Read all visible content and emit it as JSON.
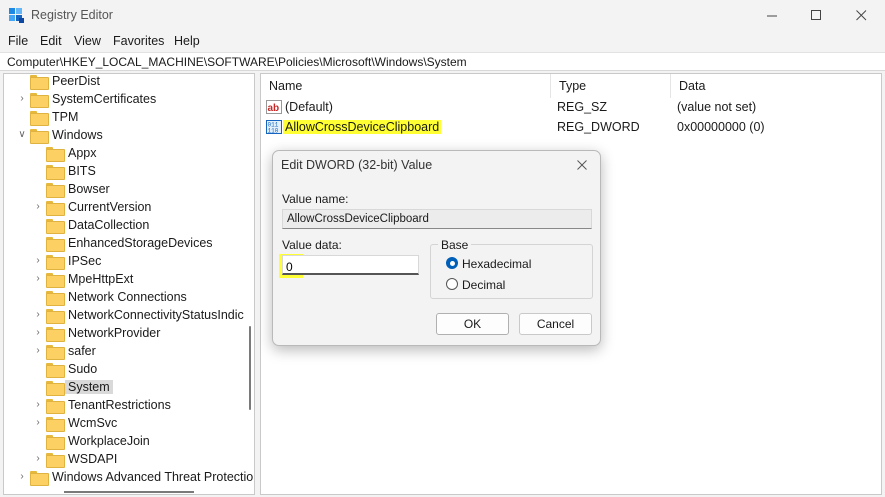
{
  "window": {
    "title": "Registry Editor",
    "minimize_icon": "minimize-icon",
    "maximize_icon": "maximize-icon",
    "close_icon": "close-icon"
  },
  "menu": [
    "File",
    "Edit",
    "View",
    "Favorites",
    "Help"
  ],
  "address": "Computer\\HKEY_LOCAL_MACHINE\\SOFTWARE\\Policies\\Microsoft\\Windows\\System",
  "tree": {
    "items": [
      {
        "label": "PeerDist",
        "expandable": false,
        "selected": false
      },
      {
        "label": "SystemCertificates",
        "expandable": true,
        "selected": false
      },
      {
        "label": "TPM",
        "expandable": false,
        "selected": false
      },
      {
        "label": "Windows",
        "expandable": true,
        "expanded": true,
        "selected": false
      },
      {
        "label": "Appx",
        "expandable": false,
        "selected": false
      },
      {
        "label": "BITS",
        "expandable": false,
        "selected": false
      },
      {
        "label": "Bowser",
        "expandable": false,
        "selected": false
      },
      {
        "label": "CurrentVersion",
        "expandable": true,
        "selected": false
      },
      {
        "label": "DataCollection",
        "expandable": false,
        "selected": false
      },
      {
        "label": "EnhancedStorageDevices",
        "expandable": false,
        "selected": false
      },
      {
        "label": "IPSec",
        "expandable": true,
        "selected": false
      },
      {
        "label": "MpeHttpExt",
        "expandable": true,
        "selected": false
      },
      {
        "label": "Network Connections",
        "expandable": false,
        "selected": false
      },
      {
        "label": "NetworkConnectivityStatusIndic",
        "expandable": true,
        "selected": false
      },
      {
        "label": "NetworkProvider",
        "expandable": true,
        "selected": false
      },
      {
        "label": "safer",
        "expandable": true,
        "selected": false
      },
      {
        "label": "Sudo",
        "expandable": false,
        "selected": false
      },
      {
        "label": "System",
        "expandable": false,
        "selected": true
      },
      {
        "label": "TenantRestrictions",
        "expandable": true,
        "selected": false
      },
      {
        "label": "WcmSvc",
        "expandable": true,
        "selected": false
      },
      {
        "label": "WorkplaceJoin",
        "expandable": false,
        "selected": false
      },
      {
        "label": "WSDAPI",
        "expandable": true,
        "selected": false
      },
      {
        "label": "Windows Advanced Threat Protection",
        "expandable": true,
        "selected": false
      }
    ]
  },
  "list": {
    "columns": [
      "Name",
      "Type",
      "Data"
    ],
    "rows": [
      {
        "icon": "string-value-icon",
        "name": "(Default)",
        "type": "REG_SZ",
        "data": "(value not set)",
        "highlight": false
      },
      {
        "icon": "binary-value-icon",
        "name": "AllowCrossDeviceClipboard",
        "type": "REG_DWORD",
        "data": "0x00000000 (0)",
        "highlight": true
      }
    ]
  },
  "dialog": {
    "title": "Edit DWORD (32-bit) Value",
    "value_name_label": "Value name:",
    "value_name": "AllowCrossDeviceClipboard",
    "value_data_label": "Value data:",
    "value_data": "0",
    "base_label": "Base",
    "hex_label": "Hexadecimal",
    "dec_label": "Decimal",
    "base_selected": "Hexadecimal",
    "ok_label": "OK",
    "cancel_label": "Cancel"
  },
  "colors": {
    "highlight": "#ffff33",
    "accent": "#005fb8",
    "folder": "#fcd062"
  }
}
